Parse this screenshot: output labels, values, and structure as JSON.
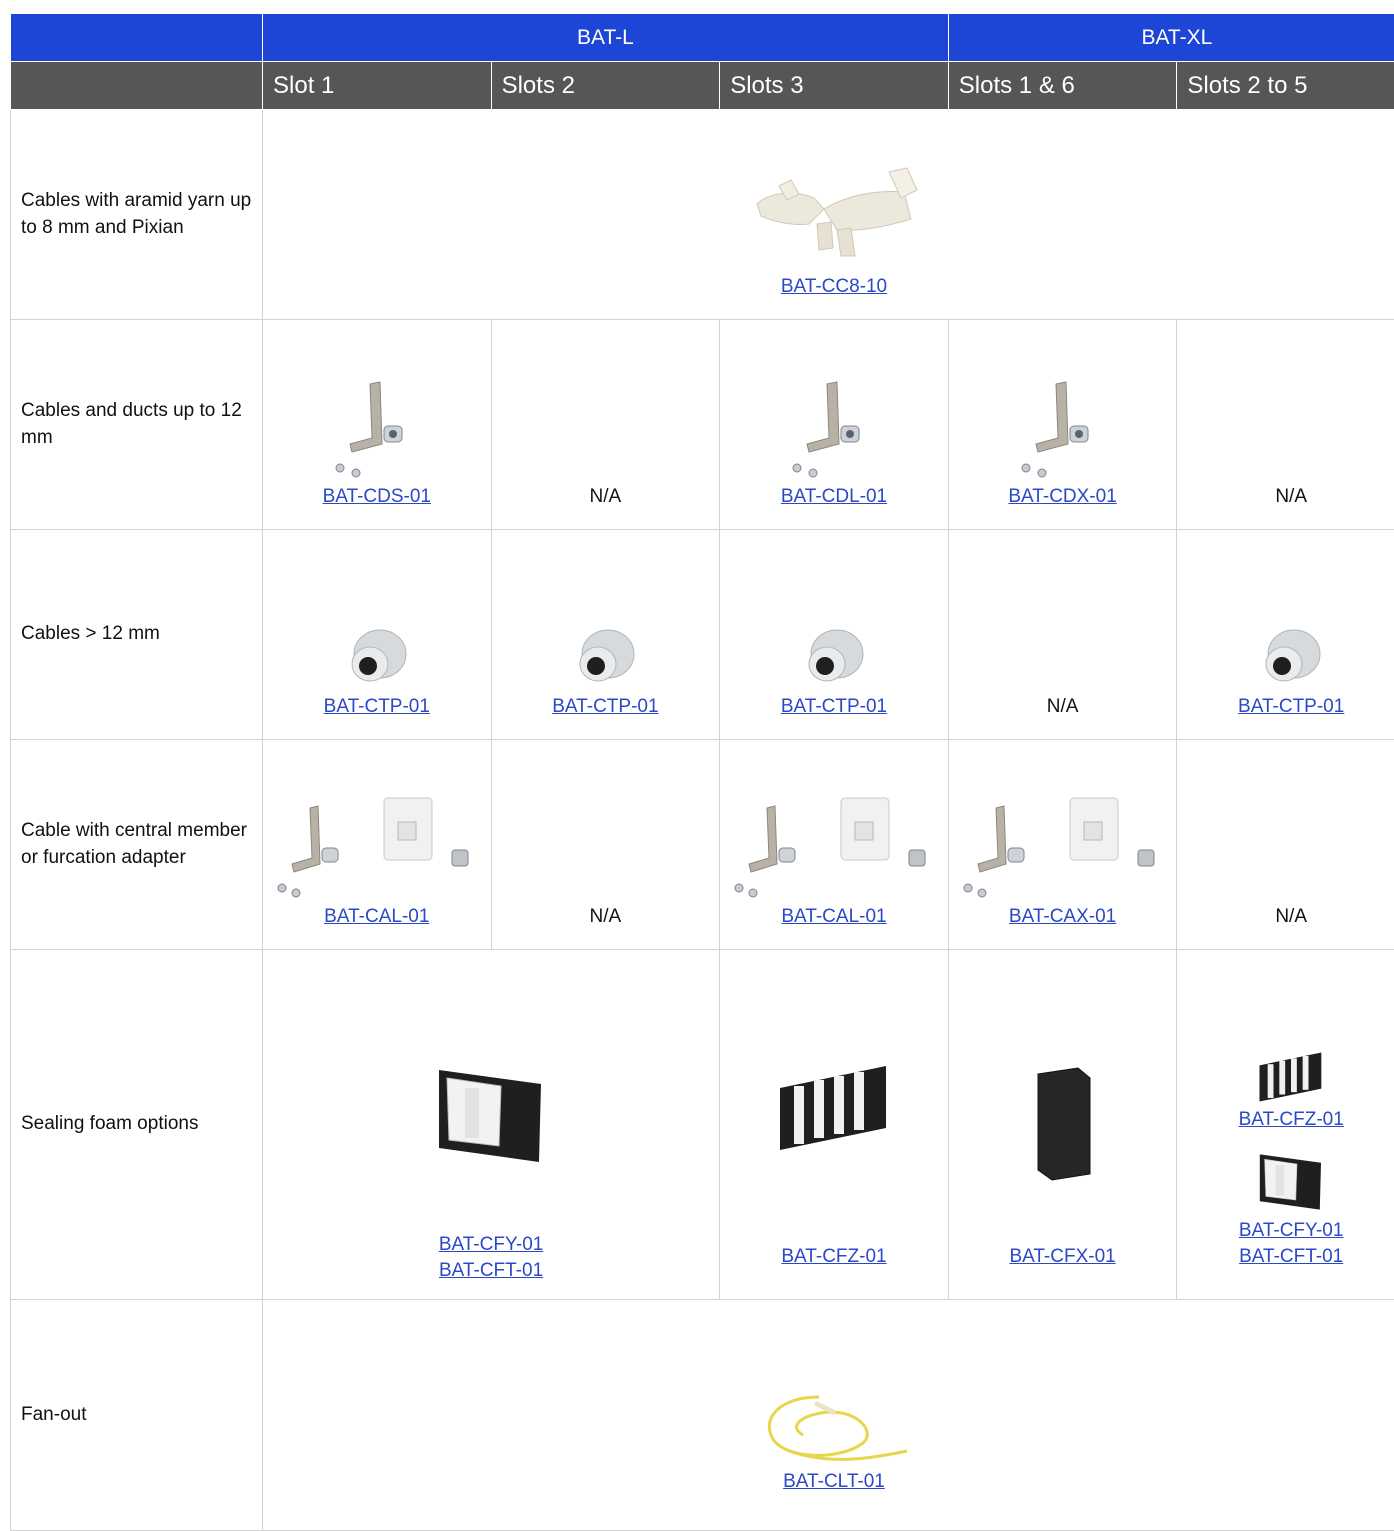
{
  "header": {
    "groups": [
      "BAT-L",
      "BAT-XL"
    ],
    "columns": [
      "Slot 1",
      "Slots 2",
      "Slots 3",
      "Slots 1 & 6",
      "Slots 2 to 5"
    ]
  },
  "rows": {
    "aramid": {
      "label": "Cables with aramid yarn up to 8 mm and Pixian",
      "link": "BAT-CC8-10"
    },
    "ducts": {
      "label": "Cables and ducts up to 12 mm",
      "slot1": "BAT-CDS-01",
      "slot2": "N/A",
      "slot3": "BAT-CDL-01",
      "xl16": "BAT-CDX-01",
      "xl25": "N/A"
    },
    "large": {
      "label": "Cables > 12 mm",
      "slot1": "BAT-CTP-01",
      "slot2": "BAT-CTP-01",
      "slot3": "BAT-CTP-01",
      "xl16": "N/A",
      "xl25": "BAT-CTP-01"
    },
    "central": {
      "label": "Cable with central member or furcation adapter",
      "slot1": "BAT-CAL-01",
      "slot2": "N/A",
      "slot3": "BAT-CAL-01",
      "xl16": "BAT-CAX-01",
      "xl25": "N/A"
    },
    "foam": {
      "label": "Sealing foam options",
      "slot12_a": "BAT-CFY-01",
      "slot12_b": "BAT-CFT-01",
      "slot3": "BAT-CFZ-01",
      "xl16": "BAT-CFX-01",
      "xl25_top": "BAT-CFZ-01",
      "xl25_a": "BAT-CFY-01",
      "xl25_b": "BAT-CFT-01"
    },
    "fanout": {
      "label": "Fan-out",
      "link": "BAT-CLT-01"
    }
  }
}
